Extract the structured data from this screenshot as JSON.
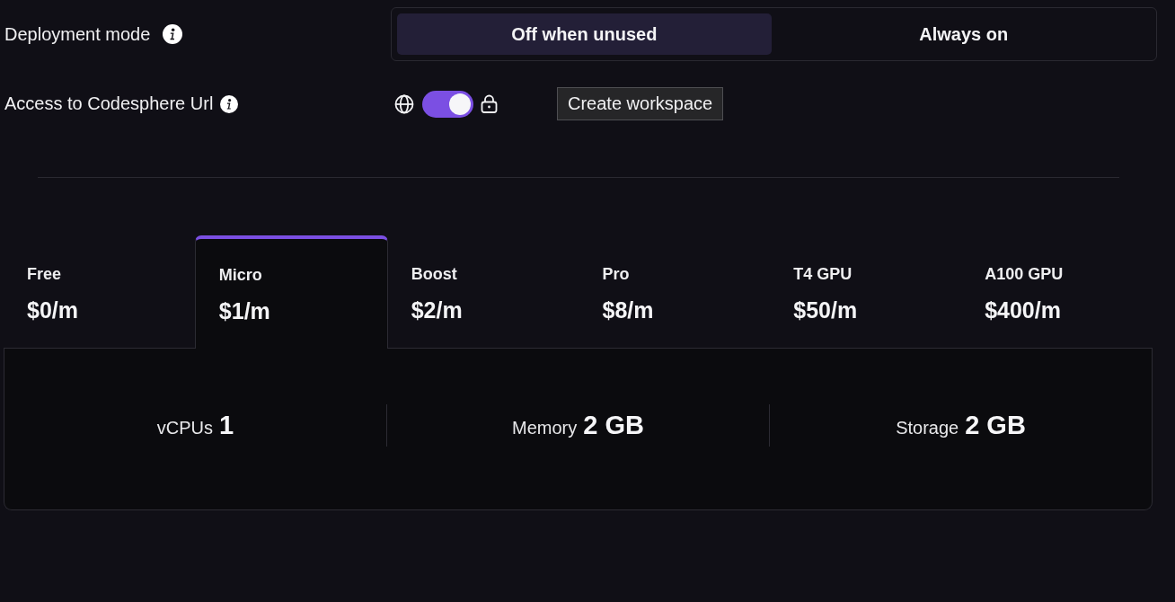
{
  "deployment_mode": {
    "label": "Deployment mode",
    "options": [
      {
        "label": "Off when unused",
        "selected": true
      },
      {
        "label": "Always on",
        "selected": false
      }
    ]
  },
  "url_access": {
    "label": "Access to Codesphere Url",
    "on": true
  },
  "create_button": {
    "label": "Create workspace"
  },
  "plans": [
    {
      "name": "Free",
      "price": "$0/m",
      "selected": false
    },
    {
      "name": "Micro",
      "price": "$1/m",
      "selected": true
    },
    {
      "name": "Boost",
      "price": "$2/m",
      "selected": false
    },
    {
      "name": "Pro",
      "price": "$8/m",
      "selected": false
    },
    {
      "name": "T4 GPU",
      "price": "$50/m",
      "selected": false
    },
    {
      "name": "A100 GPU",
      "price": "$400/m",
      "selected": false
    }
  ],
  "specs": [
    {
      "label": "vCPUs",
      "value": "1"
    },
    {
      "label": "Memory",
      "value": "2 GB"
    },
    {
      "label": "Storage",
      "value": "2 GB"
    }
  ]
}
